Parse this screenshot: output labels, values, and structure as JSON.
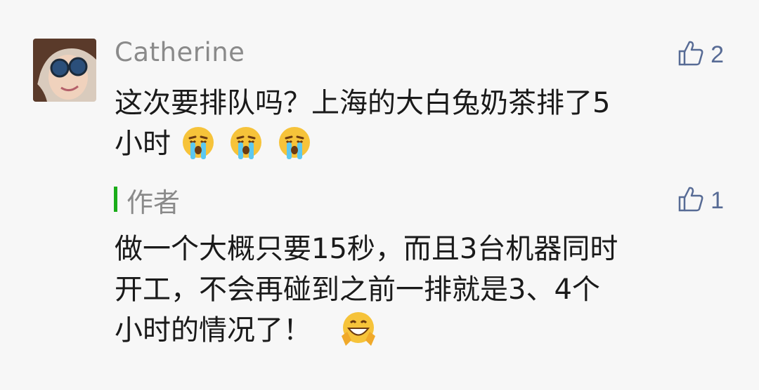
{
  "comment": {
    "username": "Catherine",
    "likes": "2",
    "text_line1": "这次要排队吗？上海的大白兔奶茶排了5",
    "text_line2": "小时",
    "emoji": [
      "crying-emoji",
      "crying-emoji",
      "crying-emoji"
    ]
  },
  "reply": {
    "author_label": "作者",
    "likes": "1",
    "text_line1": "做一个大概只要15秒，而且3台机器同时",
    "text_line2": "开工，不会再碰到之前一排就是3、4个",
    "text_line3": "小时的情况了！",
    "emoji": "grinning-hands-emoji"
  },
  "colors": {
    "accent_link": "#576b95",
    "reply_bar": "#1aad19",
    "muted_text": "#8a8a8a",
    "body_text": "#1a1a1a",
    "background": "#f7f7f7"
  }
}
